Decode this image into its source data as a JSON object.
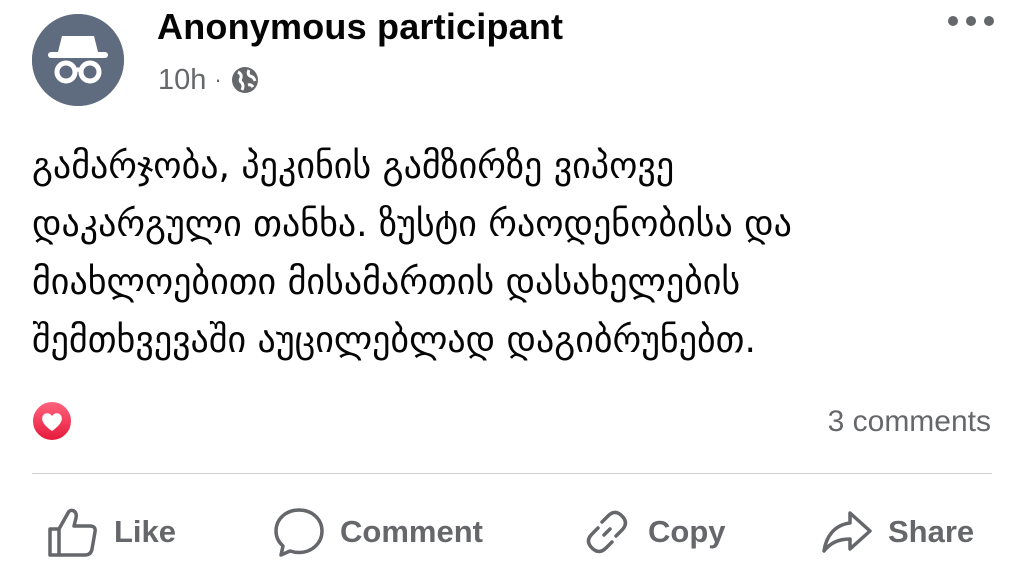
{
  "post": {
    "author": "Anonymous participant",
    "time": "10h",
    "separator": "·",
    "privacy_icon": "globe-icon",
    "more_icon": "more-horizontal-icon",
    "body": "გამარჯობა, პეკინის გამზირზე ვიპოვე\nდაკარგული თანხა. ზუსტი რაოდენობისა და\nმიახლოებითი მისამართის დასახელების\nშემთხვევაში აუცილებლად დაგიბრუნებთ.",
    "reaction_icon": "love-reaction-icon",
    "comments_count": "3 comments"
  },
  "actions": {
    "like": "Like",
    "comment": "Comment",
    "copy": "Copy",
    "share": "Share"
  },
  "colors": {
    "text": "#050505",
    "secondary": "#65676b",
    "avatar_bg": "#5f6b7e",
    "love": "#f33e58",
    "divider": "#ced0d4"
  }
}
